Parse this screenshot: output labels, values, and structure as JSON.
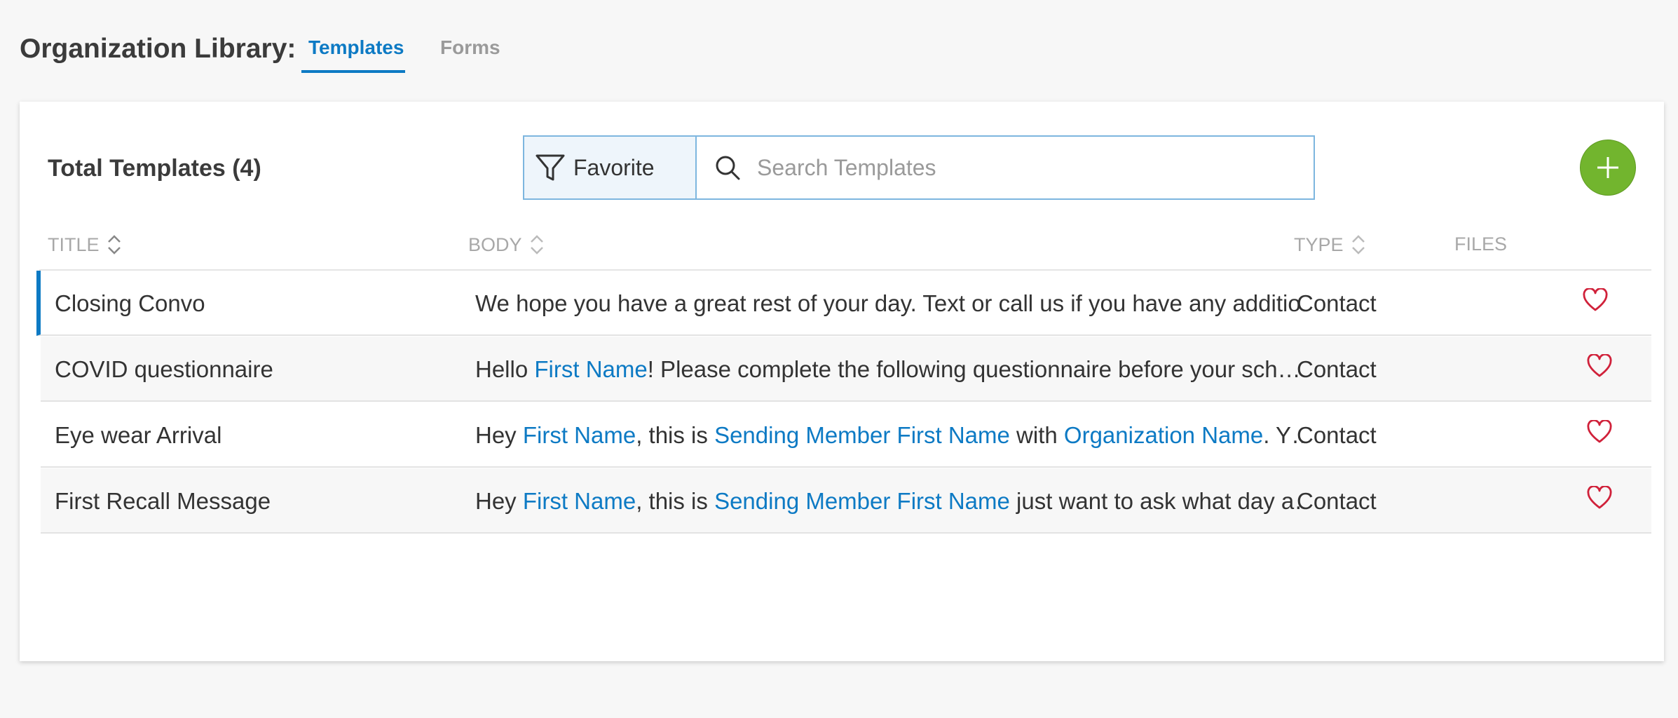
{
  "header": {
    "library_label": "Organization Library:",
    "tabs": [
      {
        "label": "Templates",
        "active": true
      },
      {
        "label": "Forms",
        "active": false
      }
    ]
  },
  "toolbar": {
    "total_label": "Total Templates (4)",
    "filter_label": "Favorite",
    "filter_icon": "funnel-icon",
    "search_placeholder": "Search Templates",
    "search_value": "",
    "add_icon": "plus-icon"
  },
  "columns": {
    "title": "TITLE",
    "body": "BODY",
    "type": "TYPE",
    "files": "FILES"
  },
  "colors": {
    "accent": "#0d7ac4",
    "add_button": "#72b52e",
    "heart": "#d0213a"
  },
  "rows": [
    {
      "title": "Closing Convo",
      "body": [
        {
          "text": "We hope you have a great rest of your day. Text or call us if you have any additio…",
          "token": false
        }
      ],
      "type": "Contact",
      "favorite_icon": "heart-outline-icon"
    },
    {
      "title": "COVID questionnaire",
      "body": [
        {
          "text": "Hello ",
          "token": false
        },
        {
          "text": "First Name",
          "token": true
        },
        {
          "text": "! Please complete the following questionnaire before your sch…",
          "token": false
        }
      ],
      "type": "Contact",
      "favorite_icon": "heart-outline-icon"
    },
    {
      "title": "Eye wear Arrival",
      "body": [
        {
          "text": "Hey ",
          "token": false
        },
        {
          "text": "First Name",
          "token": true
        },
        {
          "text": ", this is ",
          "token": false
        },
        {
          "text": "Sending Member First Name",
          "token": true
        },
        {
          "text": " with ",
          "token": false
        },
        {
          "text": "Organization Name",
          "token": true
        },
        {
          "text": ". Y…",
          "token": false
        }
      ],
      "type": "Contact",
      "favorite_icon": "heart-outline-icon"
    },
    {
      "title": "First Recall Message",
      "body": [
        {
          "text": "Hey ",
          "token": false
        },
        {
          "text": "First Name",
          "token": true
        },
        {
          "text": ", this is ",
          "token": false
        },
        {
          "text": "Sending Member First Name",
          "token": true
        },
        {
          "text": " just want to ask what day a…",
          "token": false
        }
      ],
      "type": "Contact",
      "favorite_icon": "heart-outline-icon"
    }
  ]
}
